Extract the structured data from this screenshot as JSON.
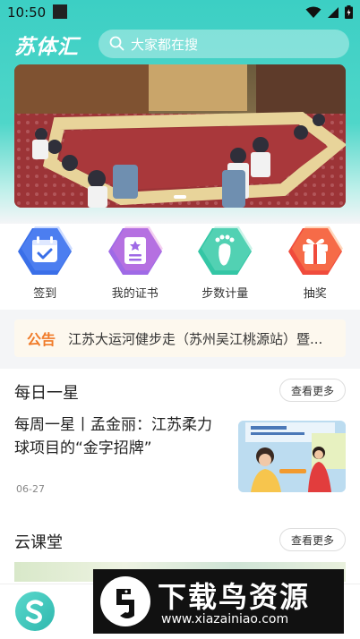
{
  "status_bar": {
    "time": "10:50"
  },
  "header": {
    "app_name": "苏体汇",
    "search": {
      "placeholder": "大家都在搜"
    }
  },
  "banner": {
    "slide_count": 1,
    "active_index": 0
  },
  "quick_menu": [
    {
      "label": "签到",
      "icon": "calendar-check-icon",
      "color": "#3a6fe8"
    },
    {
      "label": "我的证书",
      "icon": "certificate-icon",
      "color": "#9f6ae6"
    },
    {
      "label": "步数计量",
      "icon": "footprint-icon",
      "color": "#34c6a5"
    },
    {
      "label": "抽奖",
      "icon": "gift-icon",
      "color": "#f04b3c"
    }
  ],
  "notice": {
    "tag": "公告",
    "text": "江苏大运河健步走（苏州吴江桃源站）暨..."
  },
  "star_section": {
    "title": "每日一星",
    "more_label": "查看更多",
    "article": {
      "title": "每周一星丨孟金丽：江苏柔力球项目的“金字招牌”",
      "date": "06-27"
    }
  },
  "course_section": {
    "title": "云课堂",
    "more_label": "查看更多"
  },
  "watermark": {
    "title": "下载鸟资源",
    "url": "www.xiazainiao.com"
  },
  "colors": {
    "brand": "#3ccfc4",
    "notice_tag": "#f07a28"
  }
}
